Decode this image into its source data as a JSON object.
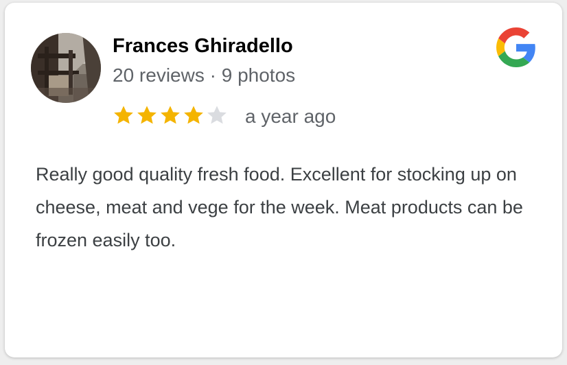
{
  "review": {
    "reviewer_name": "Frances Ghiradello",
    "reviewer_meta": "20 reviews · 9 photos",
    "rating": 4,
    "rating_max": 5,
    "time_ago": "a year ago",
    "text": "Really good quality fresh food. Excellent for stocking up on cheese, meat and vege for the week. Meat products can be frozen easily too."
  },
  "icons": {
    "star": "star-icon",
    "brand": "google-logo-icon"
  },
  "colors": {
    "star_filled": "#f4b400",
    "star_empty": "#dadce0",
    "meta_text": "#5f6368",
    "body_text": "#3c4043",
    "google_blue": "#4285F4",
    "google_red": "#EA4335",
    "google_yellow": "#FBBC05",
    "google_green": "#34A853"
  }
}
